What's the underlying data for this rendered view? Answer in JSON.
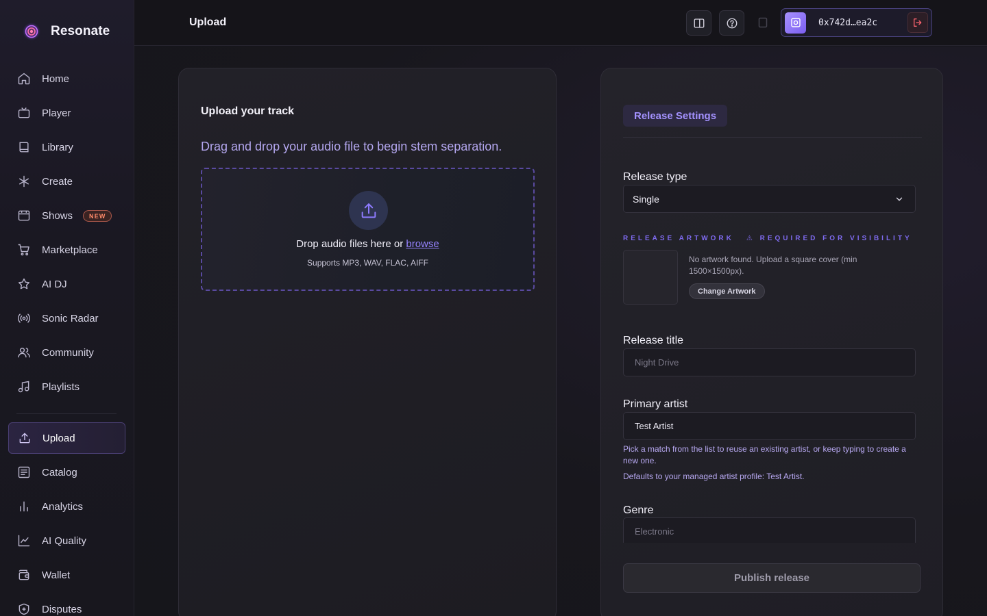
{
  "app": {
    "name": "Resonate",
    "accent": "#8e7bff"
  },
  "sidebar": {
    "items": [
      {
        "label": "Home",
        "icon": "home-icon"
      },
      {
        "label": "Player",
        "icon": "tv-icon"
      },
      {
        "label": "Library",
        "icon": "book-icon"
      },
      {
        "label": "Create",
        "icon": "asterisk-icon"
      },
      {
        "label": "Shows",
        "icon": "calendar-icon",
        "badge": "NEW"
      },
      {
        "label": "Marketplace",
        "icon": "cart-icon"
      },
      {
        "label": "AI DJ",
        "icon": "star-icon"
      },
      {
        "label": "Sonic Radar",
        "icon": "radar-icon"
      },
      {
        "label": "Community",
        "icon": "users-icon"
      },
      {
        "label": "Playlists",
        "icon": "music-note-icon"
      },
      {
        "label": "Upload",
        "icon": "upload-icon",
        "active": true
      },
      {
        "label": "Catalog",
        "icon": "list-icon"
      },
      {
        "label": "Analytics",
        "icon": "bar-chart-icon"
      },
      {
        "label": "AI Quality",
        "icon": "line-chart-icon"
      },
      {
        "label": "Wallet",
        "icon": "wallet-icon"
      },
      {
        "label": "Disputes",
        "icon": "shield-icon"
      }
    ]
  },
  "header": {
    "title": "Upload",
    "wallet_address": "0x742d…ea2c"
  },
  "upload": {
    "title": "Upload your track",
    "subtitle": "Drag and drop your audio file to begin stem separation.",
    "drop_text": "Drop audio files here or",
    "browse_label": "browse",
    "supported": "Supports MP3, WAV, FLAC, AIFF"
  },
  "settings": {
    "tab_label": "Release Settings",
    "release_type_label": "Release type",
    "release_type_value": "Single",
    "artwork_heading": "RELEASE ARTWORK",
    "artwork_warning": "⚠ REQUIRED FOR VISIBILITY",
    "artwork_note": "No artwork found. Upload a square cover (min 1500×1500px).",
    "artwork_button": "Change Artwork",
    "title_label": "Release title",
    "title_placeholder": "Night Drive",
    "artist_label": "Primary artist",
    "artist_value": "Test Artist",
    "artist_help_1": "Pick a match from the list to reuse an existing artist, or keep typing to create a new one.",
    "artist_help_2": "Defaults to your managed artist profile: Test Artist.",
    "genre_label": "Genre",
    "genre_placeholder": "Electronic",
    "publish_label": "Publish release"
  }
}
